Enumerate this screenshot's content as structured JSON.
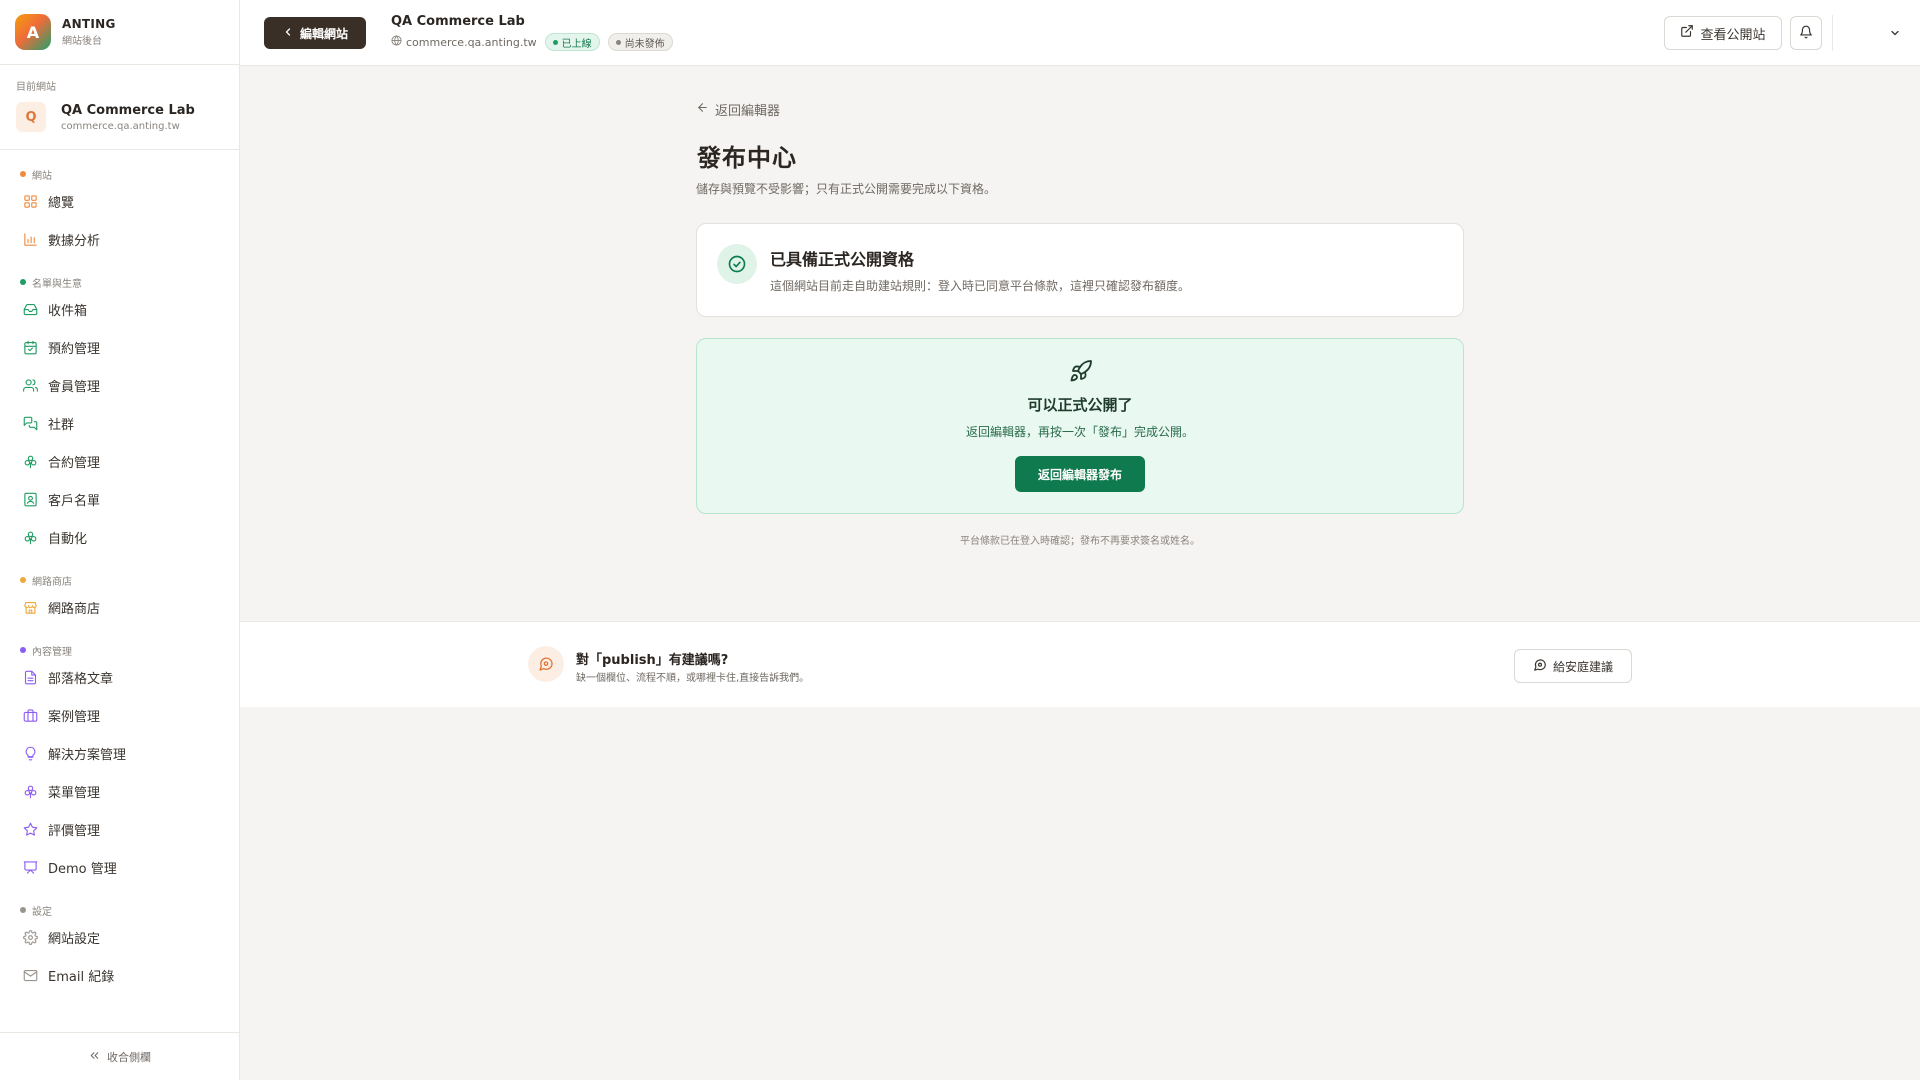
{
  "brand": {
    "logo_letter": "A",
    "name": "ANTING",
    "subtitle": "網站後台"
  },
  "current_site": {
    "label": "目前網站",
    "avatar_letter": "Q",
    "name": "QA Commerce Lab",
    "domain": "commerce.qa.anting.tw"
  },
  "sidebar": {
    "sections": [
      {
        "title": "網站",
        "color": "#f08a3c",
        "items": [
          {
            "label": "總覽",
            "icon": "grid-icon"
          },
          {
            "label": "數據分析",
            "icon": "bar-chart-icon"
          }
        ]
      },
      {
        "title": "名單與生意",
        "color": "#1f9d63",
        "items": [
          {
            "label": "收件箱",
            "icon": "inbox-icon"
          },
          {
            "label": "預約管理",
            "icon": "calendar-icon"
          },
          {
            "label": "會員管理",
            "icon": "users-icon"
          },
          {
            "label": "社群",
            "icon": "chat-icon"
          },
          {
            "label": "合約管理",
            "icon": "clover-icon"
          },
          {
            "label": "客戶名單",
            "icon": "contact-icon"
          },
          {
            "label": "自動化",
            "icon": "clover-icon"
          }
        ]
      },
      {
        "title": "網路商店",
        "color": "#f0a83c",
        "items": [
          {
            "label": "網路商店",
            "icon": "store-icon"
          }
        ]
      },
      {
        "title": "內容管理",
        "color": "#8b5cf6",
        "items": [
          {
            "label": "部落格文章",
            "icon": "document-icon"
          },
          {
            "label": "案例管理",
            "icon": "briefcase-icon"
          },
          {
            "label": "解決方案管理",
            "icon": "lightbulb-icon"
          },
          {
            "label": "菜單管理",
            "icon": "clover-icon"
          },
          {
            "label": "評價管理",
            "icon": "star-icon"
          },
          {
            "label": "Demo 管理",
            "icon": "presentation-icon"
          }
        ]
      },
      {
        "title": "設定",
        "color": "#9a948e",
        "items": [
          {
            "label": "網站設定",
            "icon": "gear-icon"
          },
          {
            "label": "Email 紀錄",
            "icon": "mail-icon"
          }
        ]
      }
    ],
    "collapse_label": "收合側欄"
  },
  "topbar": {
    "edit_site_label": "編輯網站",
    "site_name": "QA Commerce Lab",
    "site_domain": "commerce.qa.anting.tw",
    "badge_live": "已上線",
    "badge_unpublished": "尚未發佈",
    "view_public_label": "查看公開站"
  },
  "main": {
    "back_label": "返回編輯器",
    "title": "發布中心",
    "description": "儲存與預覽不受影響；只有正式公開需要完成以下資格。",
    "eligibility": {
      "title": "已具備正式公開資格",
      "description": "這個網站目前走自助建站規則：登入時已同意平台條款，這裡只確認發布額度。"
    },
    "ready": {
      "title": "可以正式公開了",
      "description": "返回編輯器，再按一次「發布」完成公開。",
      "button_label": "返回編輯器發布"
    },
    "footnote": "平台條款已在登入時確認；發布不再要求簽名或姓名。"
  },
  "feedback": {
    "title": "對「publish」有建議嗎?",
    "description": "缺一個欄位、流程不順，或哪裡卡住,直接告訴我們。",
    "button_label": "給安庭建議"
  },
  "colors": {
    "accent_dark": "#3a2f27",
    "success": "#0f7a4e",
    "success_bg": "#e9f8f0"
  }
}
